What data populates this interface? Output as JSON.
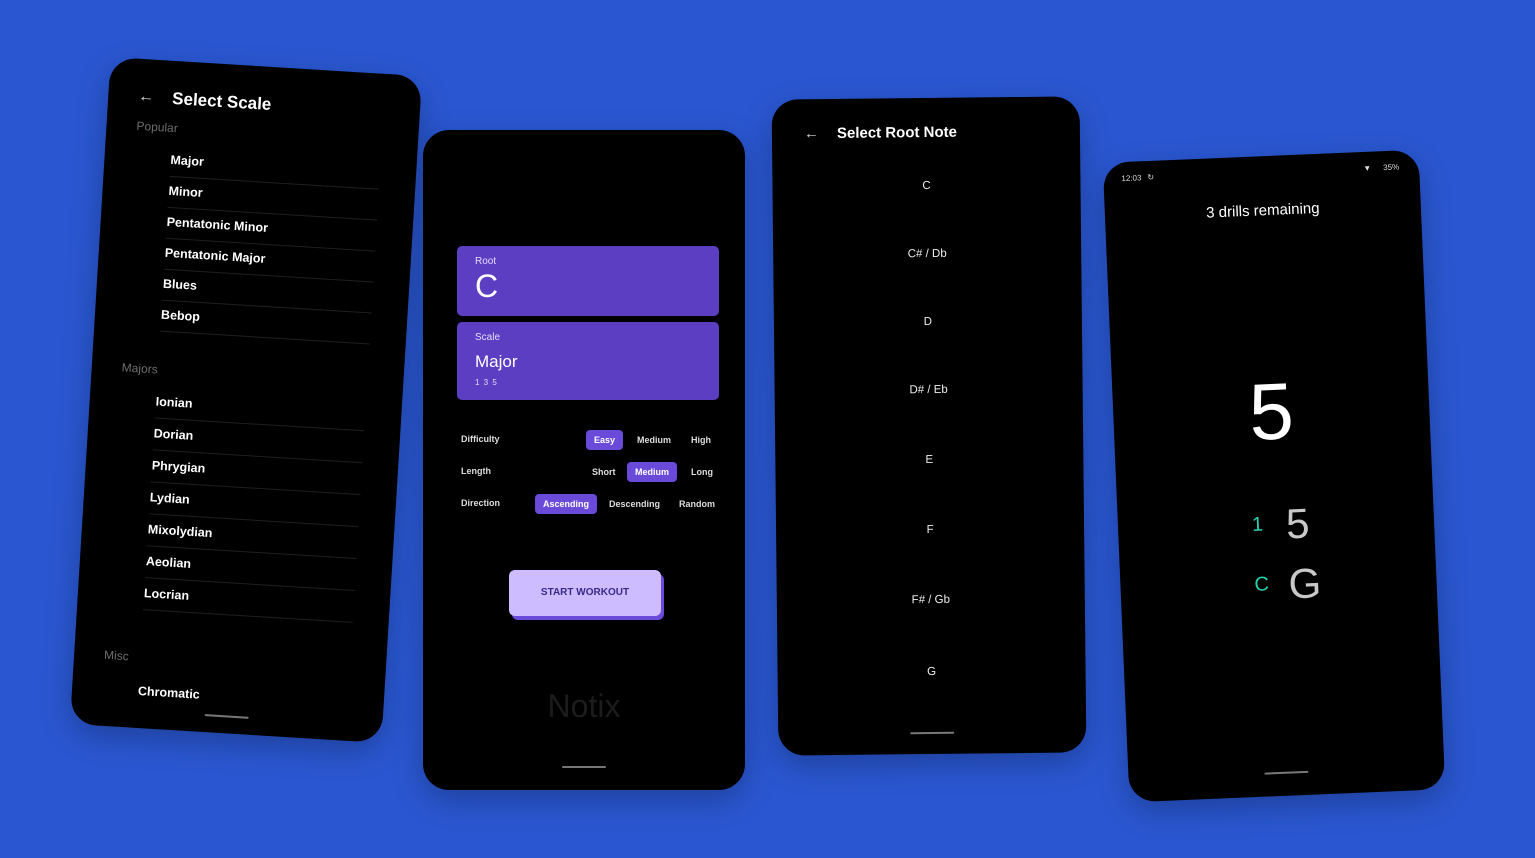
{
  "scale_screen": {
    "title": "Select Scale",
    "back_icon": "arrow-left-icon",
    "sections": [
      {
        "label": "Popular",
        "items": [
          "Major",
          "Minor",
          "Pentatonic Minor",
          "Pentatonic Major",
          "Blues",
          "Bebop"
        ]
      },
      {
        "label": "Majors",
        "items": [
          "Ionian",
          "Dorian",
          "Phrygian",
          "Lydian",
          "Mixolydian",
          "Aeolian",
          "Locrian"
        ]
      },
      {
        "label": "Misc",
        "items": [
          "Chromatic"
        ]
      }
    ]
  },
  "setup_screen": {
    "root": {
      "label": "Root",
      "value": "C"
    },
    "scale": {
      "label": "Scale",
      "value": "Major",
      "degrees": "1 3 5"
    },
    "options": [
      {
        "name": "Difficulty",
        "choices": [
          "Easy",
          "Medium",
          "High"
        ],
        "selected": "Easy"
      },
      {
        "name": "Length",
        "choices": [
          "Short",
          "Medium",
          "Long"
        ],
        "selected": "Medium"
      },
      {
        "name": "Direction",
        "choices": [
          "Ascending",
          "Descending",
          "Random"
        ],
        "selected": "Ascending"
      }
    ],
    "start_button": "START WORKOUT",
    "brand": "Notix",
    "accent": "#5b3ec2",
    "button_color": "#cdbcff"
  },
  "root_screen": {
    "title": "Select Root Note",
    "back_icon": "arrow-left-icon",
    "notes": [
      "C",
      "C# / Db",
      "D",
      "D# / Eb",
      "E",
      "F",
      "F# / Gb",
      "G"
    ]
  },
  "workout_screen": {
    "time": "12:03",
    "battery": "35%",
    "drills_remaining": "3 drills remaining",
    "current_degree": "5",
    "rows": [
      {
        "small": "1",
        "large": "5"
      },
      {
        "small": "C",
        "large": "G"
      }
    ],
    "hint_color": "#26d1b0"
  },
  "background_color": "#2a57d1"
}
